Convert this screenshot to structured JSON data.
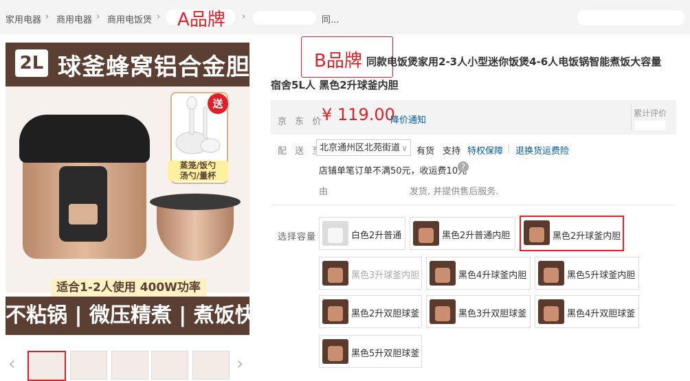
{
  "breadcrumb": {
    "items": [
      "家用电器",
      "商用电器",
      "商用电饭煲"
    ],
    "brand_label": "A品牌",
    "shop_suffix": "同..."
  },
  "hero": {
    "capacity_badge": "2L",
    "title": "球釜蜂窝铝合金胆",
    "gift_badge": "送",
    "accessory_label_1": "蒸笼/饭勺",
    "accessory_label_2": "汤勺/量杯",
    "usage": "适合1-2人使用 400W功率",
    "features": "不粘锅 | 微压精煮 | 煮饭快"
  },
  "thumbnails": {
    "prev_arrow": "‹",
    "next_arrow": "›",
    "count": 5,
    "selected_index": 0
  },
  "product": {
    "brand_label": "B品牌",
    "title_line1": "同款电饭煲家用2-3人小型迷你饭煲4-6人电饭锅智能煮饭大容量",
    "title_line2": "宿舍5L人 黑色2升球釜内胆"
  },
  "price": {
    "label": "京 东 价",
    "value": "¥ 119.00",
    "notify": "降价通知",
    "reviews_label": "累计评价"
  },
  "delivery": {
    "label": "配 送 至",
    "address": "北京通州区北苑街道",
    "stock": "有货",
    "support": "支持",
    "service1": "特权保障",
    "divider": "|",
    "service2": "退换货运费险",
    "shipping": "店铺单笔订单不满50元，收运费10元",
    "help_icon": "?",
    "by_prefix": "由",
    "by_suffix": "发货, 并提供售后服务."
  },
  "options": {
    "label": "选择容量",
    "items": [
      {
        "label": "白色2升普通",
        "available": true,
        "selected": false,
        "image": "white-cooker"
      },
      {
        "label": "黑色2升普通内胆",
        "available": true,
        "selected": false,
        "image": "rose-cooker"
      },
      {
        "label": "黑色2升球釜内胆",
        "available": true,
        "selected": true,
        "image": "rose-cooker"
      },
      {
        "label": "黑色3升球釜内胆",
        "available": false,
        "selected": false,
        "image": "rose-cooker"
      },
      {
        "label": "黑色4升球釜内胆",
        "available": true,
        "selected": false,
        "image": "rose-cooker"
      },
      {
        "label": "黑色5升球釜内胆",
        "available": true,
        "selected": false,
        "image": "rose-cooker"
      },
      {
        "label": "黑色2升双胆球釜",
        "available": true,
        "selected": false,
        "image": "rose-cooker"
      },
      {
        "label": "黑色3升双胆球釜",
        "available": true,
        "selected": false,
        "image": "rose-cooker"
      },
      {
        "label": "黑色4升双胆球釜",
        "available": true,
        "selected": false,
        "image": "rose-cooker"
      },
      {
        "label": "黑色5升双胆球釜",
        "available": true,
        "selected": false,
        "image": "rose-cooker"
      }
    ]
  },
  "colors": {
    "accent_red": "#e31e26",
    "link_blue": "#005ea7",
    "brown": "#5b3f32"
  }
}
